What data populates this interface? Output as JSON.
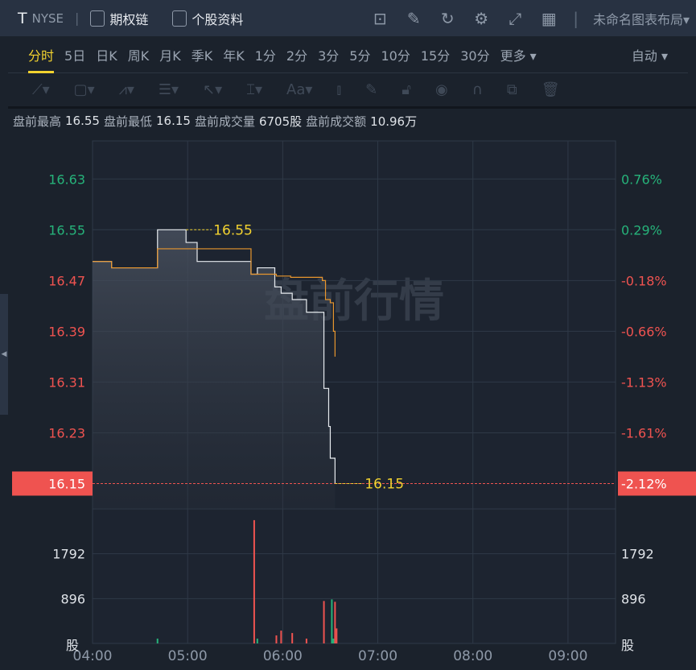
{
  "header": {
    "symbol": "T",
    "exchange": "NYSE",
    "options_chain": "期权链",
    "stock_info": "个股资料",
    "layout_name": "未命名图表布局▾",
    "tool_icons": [
      "indicator-icon",
      "draw-pencil-icon",
      "refresh-icon",
      "settings-gear-icon",
      "fullscreen-icon",
      "grid-layout-icon"
    ]
  },
  "periods": {
    "items": [
      "分时",
      "5日",
      "日K",
      "周K",
      "月K",
      "季K",
      "年K",
      "1分",
      "2分",
      "3分",
      "5分",
      "10分",
      "15分",
      "30分",
      "更多 ▾"
    ],
    "active": 0,
    "scale": "自动 ▾"
  },
  "drawing_tools": [
    "line-tool-icon",
    "rectangle-tool-icon",
    "wave-tool-icon",
    "gann-tool-icon",
    "arrow-tool-icon",
    "range-tool-icon",
    "text-tool-icon",
    "candle-tool-icon",
    "brush-icon",
    "lock-icon",
    "eye-icon",
    "magnet-icon",
    "clone-icon",
    "trash-icon"
  ],
  "stats": {
    "high_label": "盘前最高",
    "high": "16.55",
    "low_label": "盘前最低",
    "low": "16.15",
    "vol_label": "盘前成交量",
    "vol": "6705股",
    "amt_label": "盘前成交额",
    "amt": "10.96万"
  },
  "watermark": "盘前行情",
  "colors": {
    "up": "#ef5350",
    "down": "#26b37a",
    "price_line": "#e8ecf0",
    "avg_line": "#e8962e",
    "highlight": "#f2d22f"
  },
  "chart_data": {
    "type": "line",
    "x_ticks": [
      "04:00",
      "05:00",
      "06:00",
      "07:00",
      "08:00",
      "09:00"
    ],
    "xlim": [
      "04:00",
      "09:30"
    ],
    "ylim": [
      16.11,
      16.69
    ],
    "y_ticks": [
      {
        "price": "16.63",
        "pct": "0.76%",
        "dir": "up"
      },
      {
        "price": "16.55",
        "pct": "0.29%",
        "dir": "up"
      },
      {
        "price": "16.47",
        "pct": "-0.18%",
        "dir": "down"
      },
      {
        "price": "16.39",
        "pct": "-0.66%",
        "dir": "down"
      },
      {
        "price": "16.31",
        "pct": "-1.13%",
        "dir": "down"
      },
      {
        "price": "16.23",
        "pct": "-1.61%",
        "dir": "down"
      }
    ],
    "current": {
      "price": "16.15",
      "pct": "-2.12%"
    },
    "high_label": "16.55",
    "low_label": "16.15",
    "price": [
      [
        "04:00",
        16.5
      ],
      [
        "04:12",
        16.49
      ],
      [
        "04:41",
        16.55
      ],
      [
        "04:59",
        16.53
      ],
      [
        "05:06",
        16.5
      ],
      [
        "05:40",
        16.48
      ],
      [
        "05:44",
        16.49
      ],
      [
        "05:55",
        16.46
      ],
      [
        "05:59",
        16.45
      ],
      [
        "06:06",
        16.44
      ],
      [
        "06:15",
        16.42
      ],
      [
        "06:25",
        16.42
      ],
      [
        "06:26",
        16.3
      ],
      [
        "06:29",
        16.24
      ],
      [
        "06:30",
        16.19
      ],
      [
        "06:33",
        16.15
      ]
    ],
    "avg": [
      [
        "04:00",
        16.5
      ],
      [
        "04:12",
        16.49
      ],
      [
        "04:41",
        16.52
      ],
      [
        "05:40",
        16.48
      ],
      [
        "05:56",
        16.477
      ],
      [
        "06:05",
        16.475
      ],
      [
        "06:25",
        16.47
      ],
      [
        "06:27",
        16.44
      ],
      [
        "06:30",
        16.435
      ],
      [
        "06:32",
        16.39
      ],
      [
        "06:33",
        16.35
      ]
    ],
    "volume_ticks": [
      "1792",
      "896"
    ],
    "volume_unit": "股",
    "volume_max": 2688,
    "volume": [
      [
        "04:41",
        96,
        "down"
      ],
      [
        "05:42",
        2464,
        "up"
      ],
      [
        "05:44",
        96,
        "down"
      ],
      [
        "05:56",
        160,
        "up"
      ],
      [
        "05:59",
        256,
        "up"
      ],
      [
        "06:06",
        208,
        "up"
      ],
      [
        "06:15",
        96,
        "up"
      ],
      [
        "06:26",
        848,
        "up"
      ],
      [
        "06:31",
        880,
        "down"
      ],
      [
        "06:32",
        96,
        "down"
      ],
      [
        "06:33",
        832,
        "up"
      ],
      [
        "06:34",
        300,
        "up"
      ]
    ]
  }
}
